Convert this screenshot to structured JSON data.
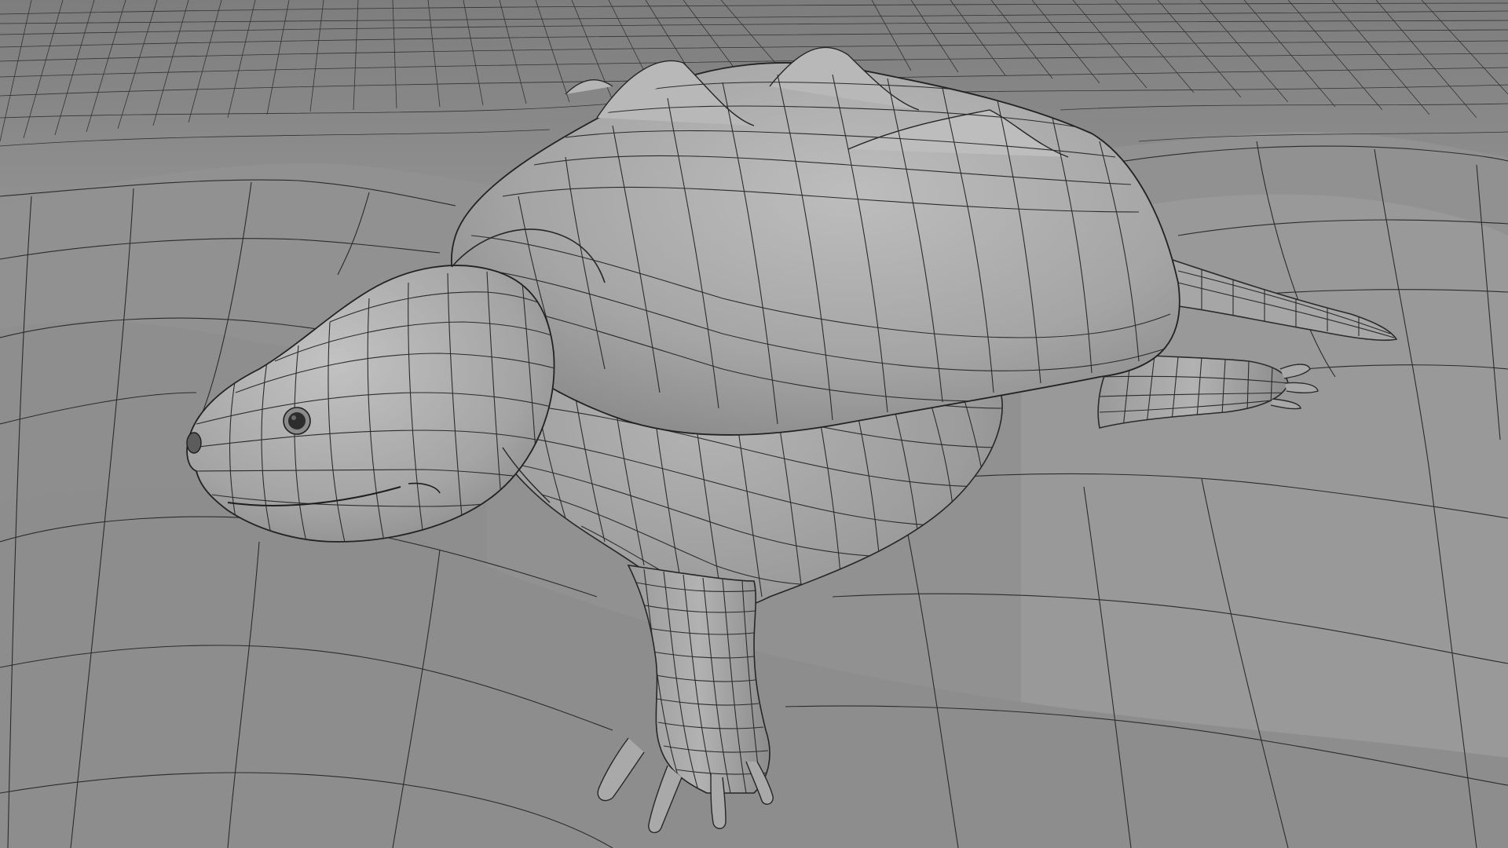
{
  "scene": {
    "subject": "snapping-turtle-mesh",
    "shading": "gray-clay-with-wireframe",
    "colors": {
      "ground": "#8c8c8c",
      "ground_light": "#a0a0a0",
      "body": "#a3a3a3",
      "body_light": "#bdbdbd",
      "body_dark": "#7f7f7f",
      "wire": "#2b2b2b"
    }
  }
}
